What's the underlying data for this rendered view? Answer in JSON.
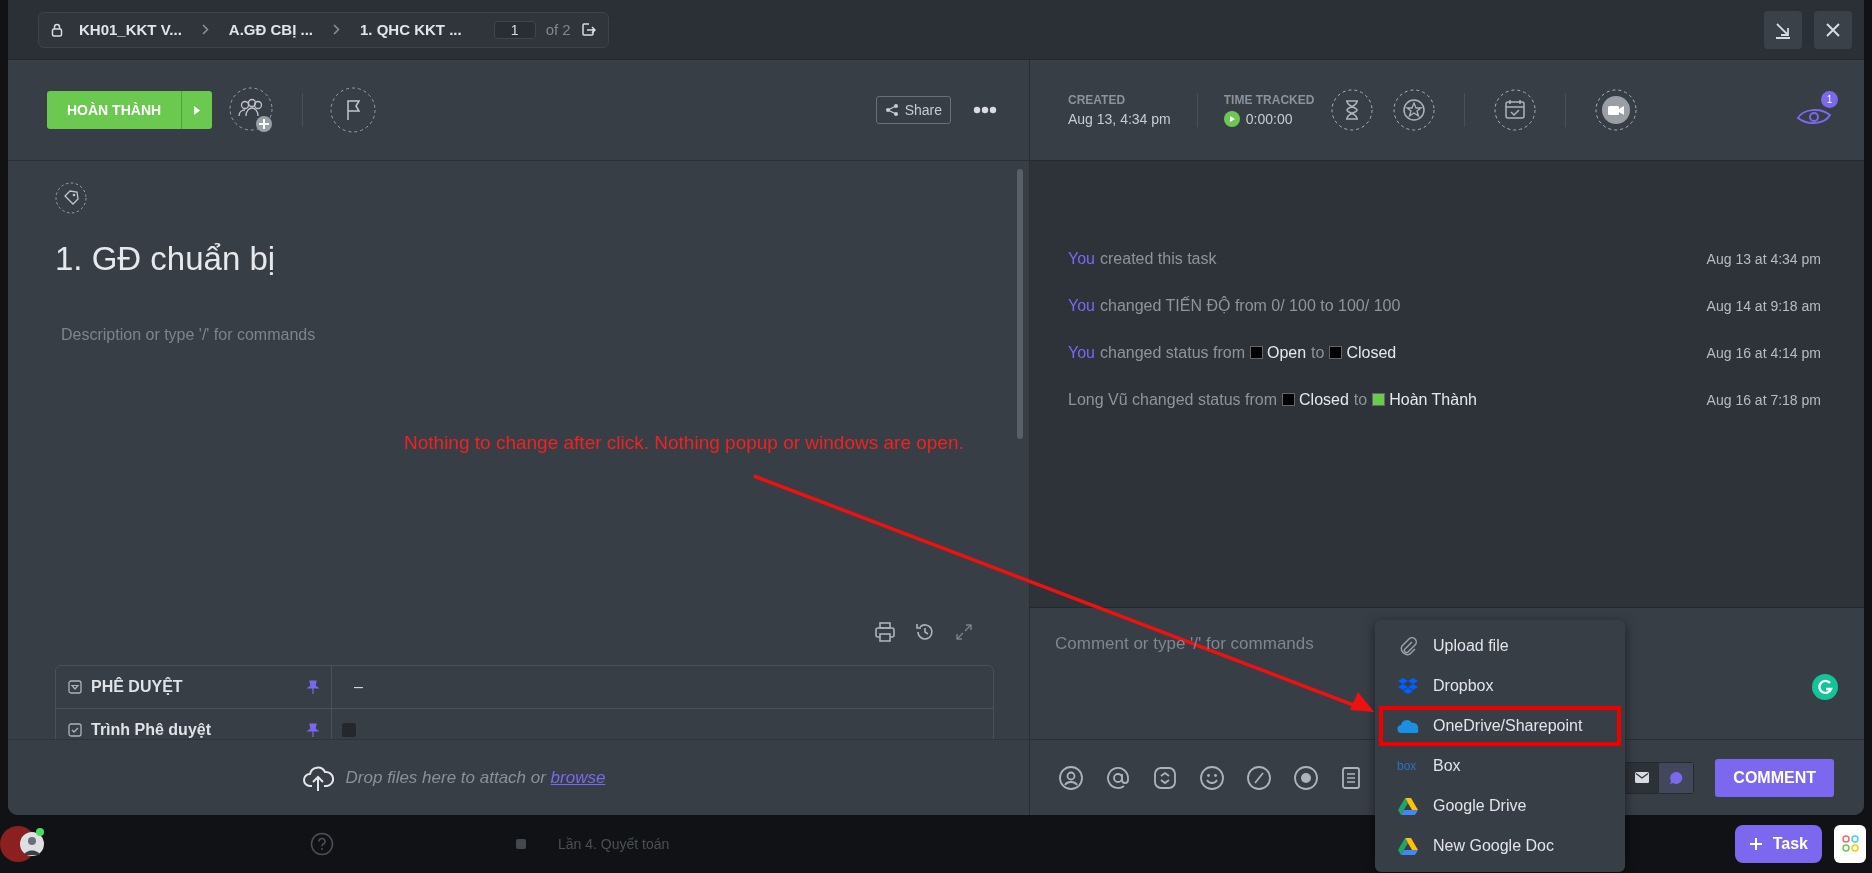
{
  "breadcrumb": {
    "items": [
      "KH01_KKT V...",
      "A.GĐ CBỊ ...",
      "1. QHC KKT ..."
    ],
    "page": "1",
    "of": "of 2"
  },
  "status_button": {
    "label": "HOÀN THÀNH",
    "color": "#6bc950"
  },
  "share": "Share",
  "task": {
    "title": "1. GĐ chuẩn bị",
    "description_placeholder": "Description or type '/' for commands"
  },
  "custom_fields": [
    {
      "kind": "dropdown",
      "name": "PHÊ DUYỆT",
      "value": "–"
    },
    {
      "kind": "checkbox",
      "name": "Trình Phê duyệt",
      "checked": false
    }
  ],
  "attach": {
    "text": "Drop files here to attach or",
    "link": "browse"
  },
  "created": {
    "label": "CREATED",
    "value": "Aug 13, 4:34 pm"
  },
  "time_tracked": {
    "label": "TIME TRACKED",
    "value": "0:00:00"
  },
  "watchers": {
    "count": "1"
  },
  "activity": [
    {
      "parts": [
        {
          "kind": "you",
          "text": "You"
        },
        {
          "kind": "text",
          "text": "created this task"
        }
      ],
      "time": "Aug 13 at 4:34 pm"
    },
    {
      "parts": [
        {
          "kind": "you",
          "text": "You"
        },
        {
          "kind": "text",
          "text": "changed TIẾN ĐỘ from 0/ 100 to 100/ 100"
        }
      ],
      "time": "Aug 14 at 9:18 am"
    },
    {
      "parts": [
        {
          "kind": "you",
          "text": "You"
        },
        {
          "kind": "text",
          "text": "changed status from"
        },
        {
          "kind": "status",
          "text": "Open",
          "color": "#000000"
        },
        {
          "kind": "text",
          "text": "to"
        },
        {
          "kind": "status",
          "text": "Closed",
          "color": "#000000"
        }
      ],
      "time": "Aug 16 at 4:14 pm"
    },
    {
      "parts": [
        {
          "kind": "text",
          "text": "Long Vũ changed status from"
        },
        {
          "kind": "status",
          "text": "Closed",
          "color": "#000000"
        },
        {
          "kind": "text",
          "text": "to"
        },
        {
          "kind": "status",
          "text": "Hoàn Thành",
          "color": "#6bc950"
        }
      ],
      "time": "Aug 16 at 7:18 pm"
    }
  ],
  "comment": {
    "placeholder": "Comment or type '/' for commands",
    "mode_toggle": [
      {
        "kind": "email",
        "selected": false
      },
      {
        "kind": "comment",
        "selected": true
      }
    ],
    "button": "COMMENT"
  },
  "attach_menu": [
    {
      "kind": "upload",
      "label": "Upload file",
      "highlighted": false
    },
    {
      "kind": "dropbox",
      "label": "Dropbox",
      "highlighted": false
    },
    {
      "kind": "onedrive",
      "label": "OneDrive/Sharepoint",
      "highlighted": true
    },
    {
      "kind": "box",
      "label": "Box",
      "icon_text": "box",
      "highlighted": false
    },
    {
      "kind": "gdrive",
      "label": "Google Drive",
      "highlighted": false
    },
    {
      "kind": "gdrive",
      "label": "New Google Doc",
      "highlighted": false
    }
  ],
  "annotation": {
    "text": "Nothing to change after click. Nothing popup or windows are open."
  },
  "background": {
    "list_item": "Lần 4. Quyết toán",
    "new_task": "Task"
  }
}
